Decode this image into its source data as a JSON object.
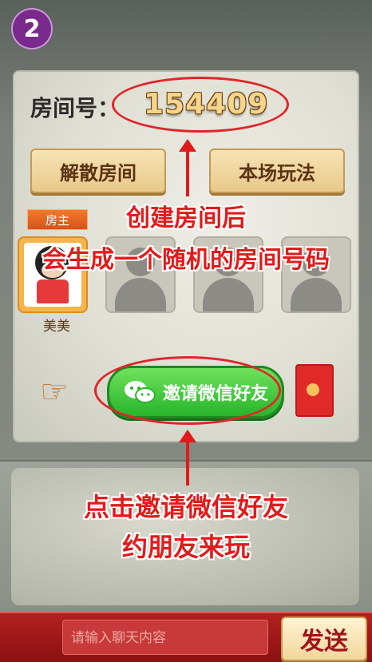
{
  "step": "2",
  "room": {
    "label": "房间号：",
    "number": "154409",
    "dismiss_label": "解散房间",
    "rules_label": "本场玩法",
    "host_tag": "房主",
    "host_name": "美美",
    "invite_label": "邀请微信好友"
  },
  "annotations": {
    "top_line1": "创建房间后",
    "top_line2": "会生成一个随机的房间号码",
    "bottom_line1": "点击邀请微信好友",
    "bottom_line2": "约朋友来玩"
  },
  "chat": {
    "placeholder": "请输入聊天内容",
    "send_label": "发送"
  },
  "colors": {
    "accent_red": "#e11b1b",
    "invite_green": "#27b52b",
    "badge_purple": "#7a2a8c"
  },
  "icons": [
    "pointing-hand-icon",
    "wechat-icon",
    "red-packet-icon",
    "avatar-placeholder-icon"
  ]
}
